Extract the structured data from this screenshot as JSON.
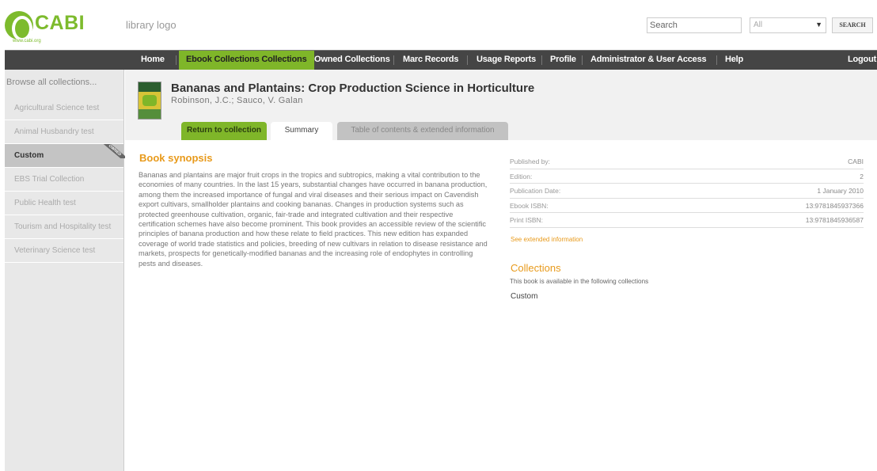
{
  "header": {
    "logo_text": "CABI",
    "logo_url": "www.cabi.org",
    "library_logo": "library logo",
    "search_placeholder": "Search",
    "search_scope": "All",
    "search_button": "SEARCH"
  },
  "nav": {
    "items": [
      {
        "label": "Home"
      },
      {
        "label": "Ebook Collections Collections"
      },
      {
        "label": "Owned Collections"
      },
      {
        "label": "Marc Records"
      },
      {
        "label": "Usage Reports"
      },
      {
        "label": "Profile"
      },
      {
        "label": "Administrator & User Access"
      },
      {
        "label": "Help"
      },
      {
        "label": "Logout"
      }
    ],
    "active_index": 1
  },
  "sidebar": {
    "browse_label": "Browse all collections...",
    "items": [
      {
        "label": "Agricultural Science test"
      },
      {
        "label": "Animal Husbandry test"
      },
      {
        "label": "Custom",
        "badge": "OWNED"
      },
      {
        "label": "EBS Trial Collection"
      },
      {
        "label": "Public Health test"
      },
      {
        "label": "Tourism and Hospitality test"
      },
      {
        "label": "Veterinary Science test"
      }
    ],
    "active_index": 2
  },
  "book": {
    "title": "Bananas and Plantains: Crop Production Science in Horticulture",
    "authors": "Robinson, J.C.; Sauco, V. Galan"
  },
  "tabs": {
    "return": "Return to collection",
    "summary": "Summary",
    "toc": "Table of contents & extended information"
  },
  "synopsis": {
    "heading": "Book synopsis",
    "text": "Bananas and plantains are major fruit crops in the tropics and subtropics, making a vital contribution to the economies of many countries. In the last 15 years, substantial changes have occurred in banana production, among them the increased importance of fungal and viral diseases and their serious impact on Cavendish export cultivars, smallholder plantains and cooking bananas. Changes in production systems such as protected greenhouse cultivation, organic, fair-trade and integrated cultivation and their respective certification schemes have also become prominent. This book provides an accessible review of the scientific principles of banana production and how these relate to field practices. This new edition has expanded coverage of world trade statistics and policies, breeding of new cultivars in relation to disease resistance and markets, prospects for genetically-modified bananas and the increasing role of endophytes in controlling pests and diseases."
  },
  "details": {
    "rows": [
      {
        "label": "Published by:",
        "value": "CABI"
      },
      {
        "label": "Edition:",
        "value": "2"
      },
      {
        "label": "Publication Date:",
        "value": "1 January 2010"
      },
      {
        "label": "Ebook ISBN:",
        "value": "13:9781845937366"
      },
      {
        "label": "Print ISBN:",
        "value": "13:9781845936587"
      }
    ],
    "see_extended": "See extended information"
  },
  "collections": {
    "heading": "Collections",
    "sub": "This book is available in the following collections",
    "items": [
      "Custom"
    ]
  },
  "colors": {
    "brand_green": "#7fb629",
    "accent_orange": "#e89a1b",
    "nav_bg": "#454545"
  }
}
